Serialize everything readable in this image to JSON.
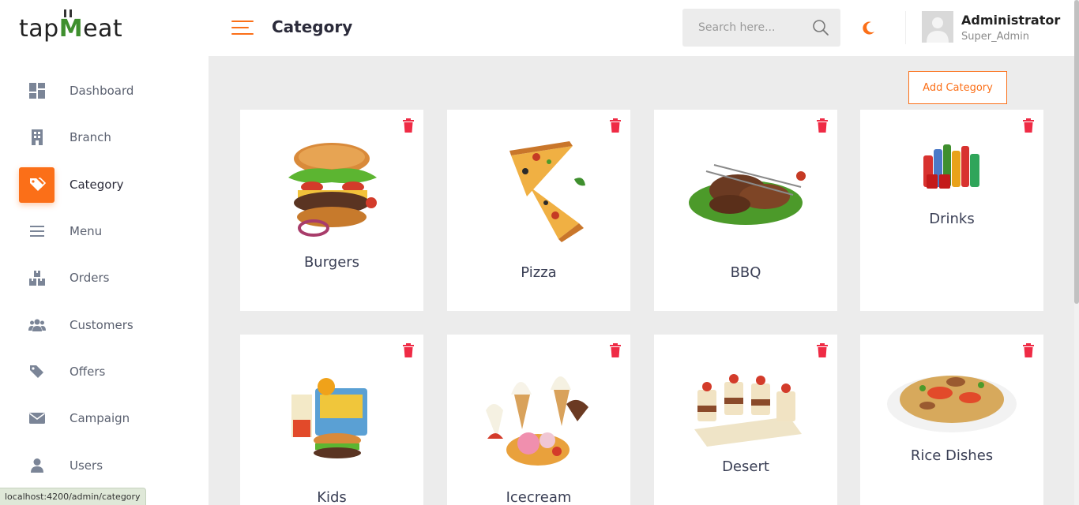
{
  "brand": {
    "logo_pre": "tap",
    "logo_mark": "M",
    "logo_post": "eat"
  },
  "sidebar": {
    "items": [
      {
        "label": "Dashboard",
        "icon": "dashboard-icon"
      },
      {
        "label": "Branch",
        "icon": "building-icon"
      },
      {
        "label": "Category",
        "icon": "tags-icon",
        "active": true
      },
      {
        "label": "Menu",
        "icon": "bars-icon"
      },
      {
        "label": "Orders",
        "icon": "boxes-icon"
      },
      {
        "label": "Customers",
        "icon": "users-icon"
      },
      {
        "label": "Offers",
        "icon": "tag-icon"
      },
      {
        "label": "Campaign",
        "icon": "envelope-icon"
      },
      {
        "label": "Users",
        "icon": "user-icon"
      }
    ]
  },
  "header": {
    "title": "Category",
    "search_placeholder": "Search here...",
    "user_name": "Administrator",
    "user_role": "Super_Admin"
  },
  "content": {
    "add_button": "Add Category",
    "categories": [
      {
        "name": "Burgers"
      },
      {
        "name": "Pizza"
      },
      {
        "name": "BBQ"
      },
      {
        "name": "Drinks"
      },
      {
        "name": "Kids"
      },
      {
        "name": "Icecream"
      },
      {
        "name": "Desert"
      },
      {
        "name": "Rice Dishes"
      }
    ]
  },
  "status_bar": {
    "url": "localhost:4200/admin/category"
  },
  "colors": {
    "accent": "#fb6f18",
    "delete": "#ef2b45",
    "brand_green": "#3f8f2e"
  }
}
